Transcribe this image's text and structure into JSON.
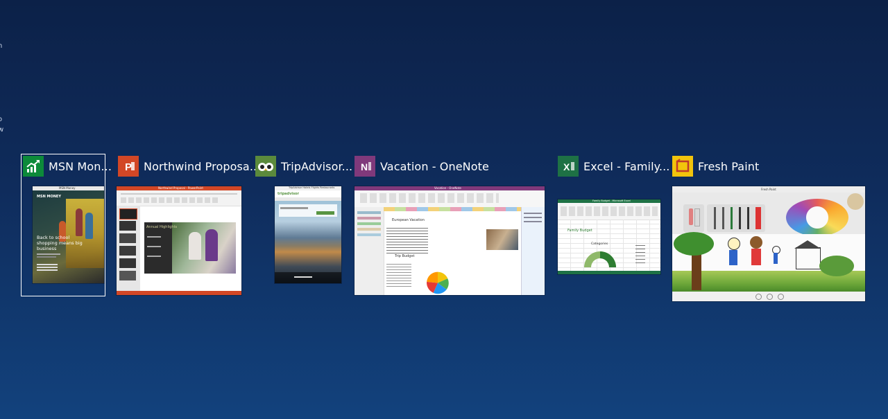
{
  "colors": {
    "msn_money": "#0d8a3a",
    "powerpoint": "#d24726",
    "tripadvisor": "#5b8a3c",
    "onenote": "#80397b",
    "excel": "#1e7145",
    "fresh_paint": "#f2c40c"
  },
  "windows": [
    {
      "title": "MSN Mon...",
      "icon": "chart-up-icon",
      "selected": true
    },
    {
      "title": "Northwind Proposa...",
      "icon": "powerpoint-icon",
      "selected": false
    },
    {
      "title": "TripAdvisor...",
      "icon": "owl-icon",
      "selected": false
    },
    {
      "title": "Vacation - OneNote",
      "icon": "onenote-icon",
      "selected": false
    },
    {
      "title": "Excel - Family...",
      "icon": "excel-icon",
      "selected": false
    },
    {
      "title": "Fresh Paint",
      "icon": "fresh-paint-icon",
      "selected": false
    }
  ],
  "thumbs": {
    "msn": {
      "bar_title": "MSN Money",
      "brand": "MSN MONEY",
      "headline": "Back to school shopping means big business"
    },
    "ppt": {
      "bar_title": "Northwind Proposal - PowerPoint",
      "slide_title": "Annual Highlights"
    },
    "trip": {
      "bar_title": "TripAdvisor Hotels Flights Restaurants",
      "brand": "tripadvisor"
    },
    "onenote": {
      "bar_title": "Vacation - OneNote",
      "page_title": "European Vacation",
      "budget_title": "Trip Budget"
    },
    "excel": {
      "bar_title": "Family Budget - Microsoft Excel",
      "sheet_title": "Family Budget",
      "chart_title": "Categories"
    },
    "paint": {
      "bar_title": "Fresh Paint"
    }
  }
}
